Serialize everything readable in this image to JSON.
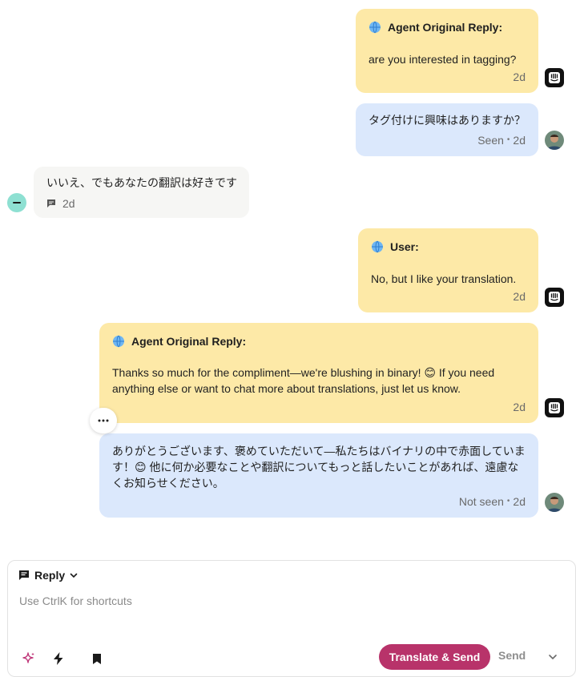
{
  "messages": [
    {
      "kind": "note",
      "title": "Agent Original Reply:",
      "text": "are you interested in tagging?",
      "time": "2d"
    },
    {
      "kind": "translation",
      "text": "タグ付けに興味はありますか？",
      "status": "Seen",
      "time": "2d"
    },
    {
      "kind": "user",
      "text": "いいえ、でもあなたの翻訳は好きです",
      "time": "2d"
    },
    {
      "kind": "note",
      "title": "User:",
      "text": "No, but I like your translation.",
      "time": "2d"
    },
    {
      "kind": "note",
      "title": "Agent Original Reply:",
      "text": "Thanks so much for the compliment—we're blushing in binary! 😊 If you need anything else or want to chat more about translations, just let us know.",
      "time": "2d"
    },
    {
      "kind": "translation",
      "text": "ありがとうございます、褒めていただいて—私たちはバイナリの中で赤面しています！😊 他に何か必要なことや翻訳についてもっと話したいことがあれば、遠慮なくお知らせください。",
      "status": "Not seen",
      "time": "2d"
    }
  ],
  "composer": {
    "tab_label": "Reply",
    "placeholder": "Use Ctrl​K for shortcuts",
    "translate_send_label": "Translate & Send",
    "send_label": "Send"
  },
  "icons": {
    "globe": "globe-icon",
    "bot_avatar": "intercom-bot-icon",
    "ai": "sparkle-icon",
    "macros": "lightning-icon",
    "saved": "bookmark-icon",
    "more": "more-horizontal-icon",
    "channel": "chat-icon",
    "chevron": "chevron-down-icon"
  },
  "colors": {
    "note_bg": "#fde9a7",
    "translation_bg": "#dbe8fc",
    "user_bg": "#f6f6f4",
    "accent": "#b8336a"
  }
}
